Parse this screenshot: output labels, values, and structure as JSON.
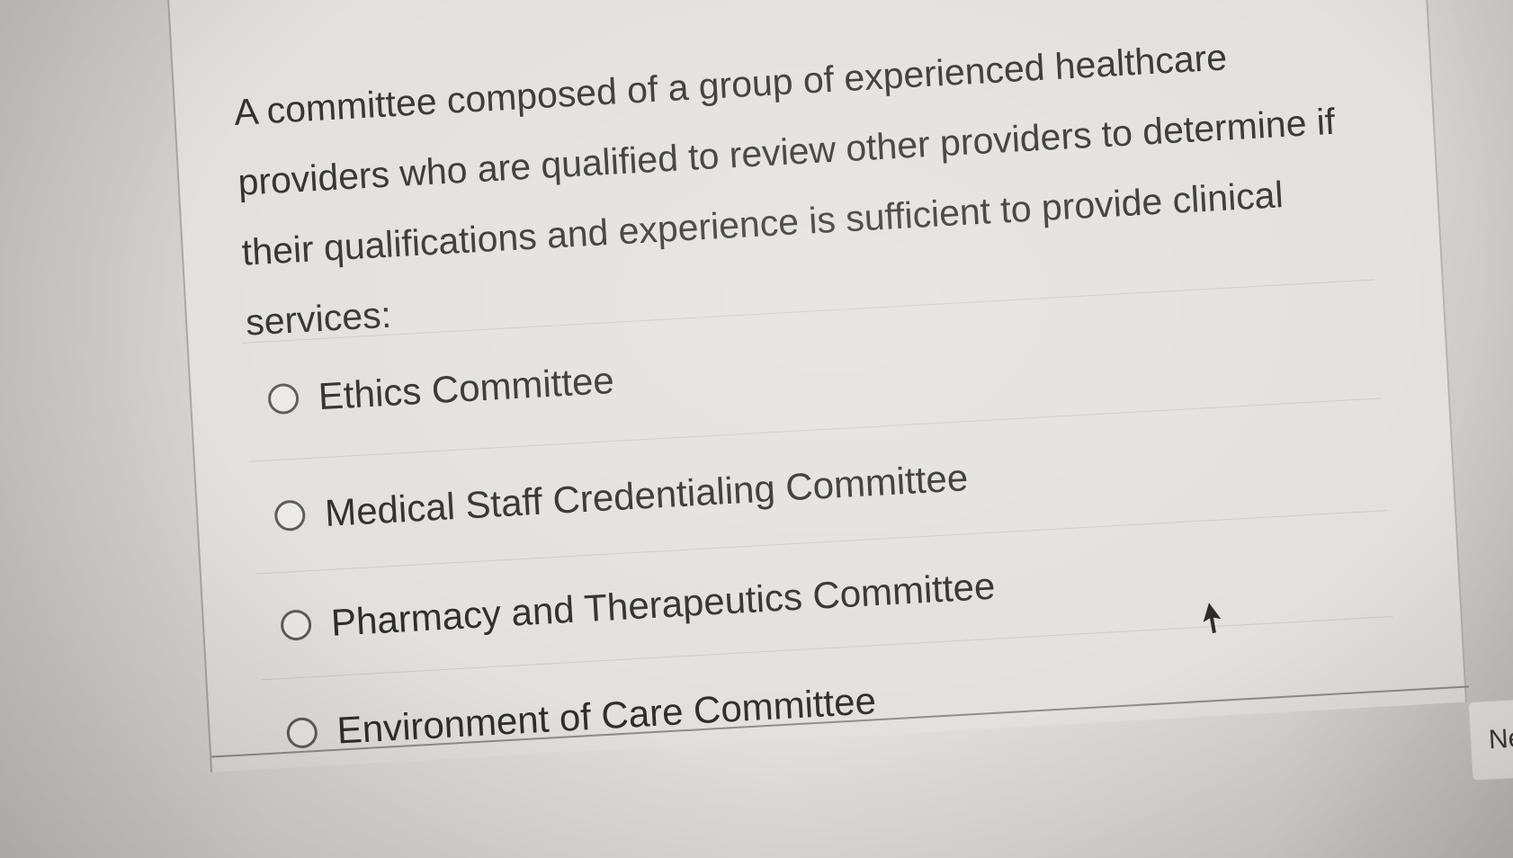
{
  "quiz": {
    "question": "A committee composed of a group of experienced healthcare providers who are qualified to review other providers to determine if their qualifications and experience is sufficient to provide clinical services:",
    "options": [
      {
        "label": "Ethics Committee",
        "selected": false
      },
      {
        "label": "Medical Staff Credentialing Committee",
        "selected": false
      },
      {
        "label": "Pharmacy and Therapeutics Committee",
        "selected": false
      },
      {
        "label": "Environment of Care Committee",
        "selected": false
      }
    ],
    "next_label": "Next"
  },
  "icons": {
    "radio": "radio-unselected-icon",
    "next_arrow": "caret-right-icon",
    "cursor": "mouse-pointer-icon"
  },
  "colors": {
    "text": "#333230",
    "card_background": "#e3e1de",
    "divider": "#cdcbc8"
  }
}
